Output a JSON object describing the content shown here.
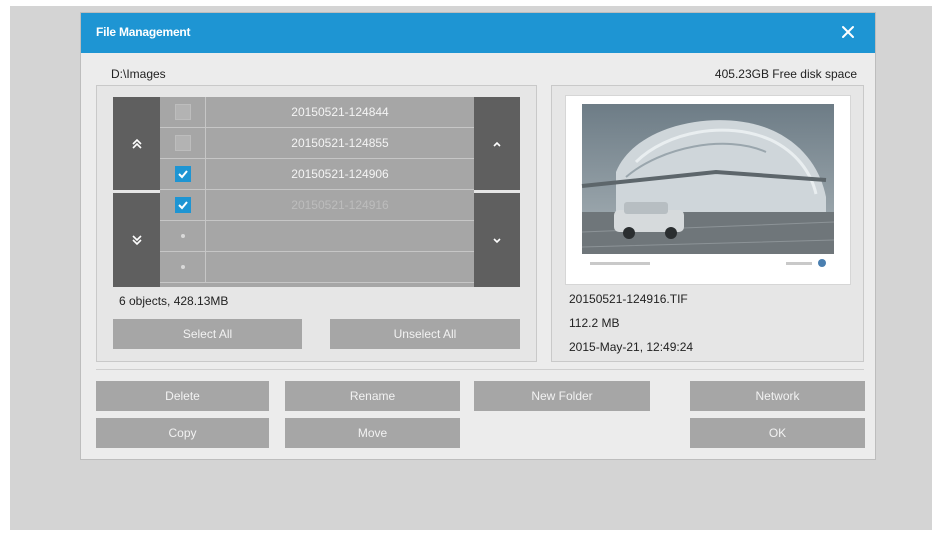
{
  "dialog": {
    "title": "File Management",
    "path": "D:\\Images",
    "free_space": "405.23GB Free disk space"
  },
  "file_list": {
    "rows": [
      {
        "name": "20150521-124844",
        "checked": false,
        "selected": false
      },
      {
        "name": "20150521-124855",
        "checked": false,
        "selected": false
      },
      {
        "name": "20150521-124906",
        "checked": true,
        "selected": false
      },
      {
        "name": "20150521-124916",
        "checked": true,
        "selected": true
      },
      {
        "name": "",
        "checked": false,
        "selected": false
      },
      {
        "name": "",
        "checked": false,
        "selected": false
      }
    ],
    "summary": "6 objects, 428.13MB",
    "select_all_label": "Select All",
    "unselect_all_label": "Unselect All"
  },
  "preview": {
    "filename": "20150521-124916.TIF",
    "size": "112.2 MB",
    "date": "2015-May-21, 12:49:24"
  },
  "actions": {
    "delete": "Delete",
    "rename": "Rename",
    "new_folder": "New Folder",
    "network": "Network",
    "copy": "Copy",
    "move": "Move",
    "ok": "OK"
  },
  "colors": {
    "titlebar": "#1e95d3",
    "checkbox_checked": "#1e95d3",
    "button": "#a6a6a6",
    "nav_button": "#5f5f5f"
  },
  "icons": {
    "close": "close-icon",
    "page_up": "double-chevron-up-icon",
    "page_down": "double-chevron-down-icon",
    "scroll_up": "chevron-up-icon",
    "scroll_down": "chevron-down-icon",
    "checkbox": "checkmark-icon"
  }
}
